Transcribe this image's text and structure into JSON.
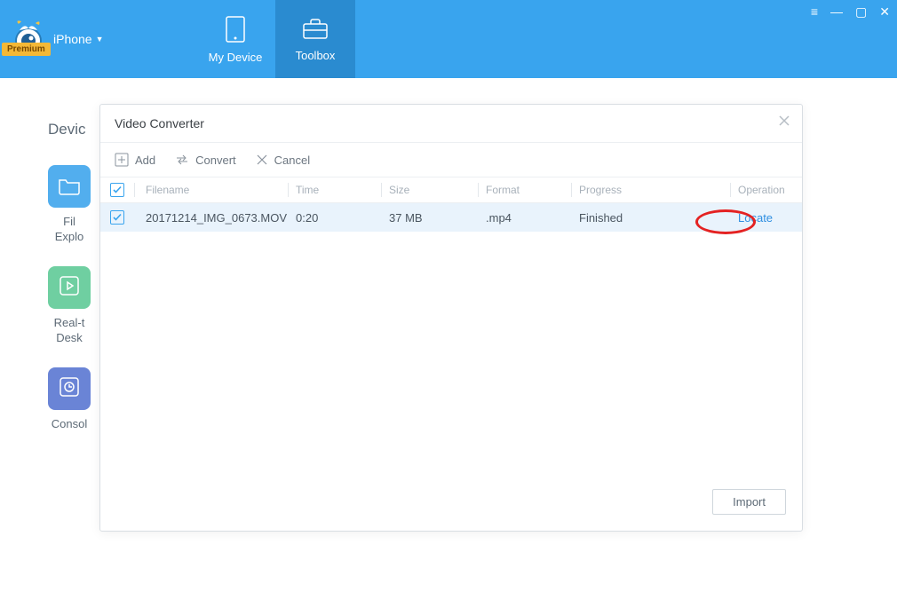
{
  "brand": {
    "device_label": "iPhone",
    "premium_badge": "Premium"
  },
  "nav": {
    "my_device": "My Device",
    "toolbox": "Toolbox"
  },
  "side": {
    "section": "Devic",
    "file_explorer": "Fil\nExplo",
    "real_time": "Real-t\nDesk",
    "console": "Consol"
  },
  "dialog": {
    "title": "Video Converter"
  },
  "toolbar": {
    "add": "Add",
    "convert": "Convert",
    "cancel": "Cancel"
  },
  "table": {
    "headers": {
      "filename": "Filename",
      "time": "Time",
      "size": "Size",
      "format": "Format",
      "progress": "Progress",
      "operation": "Operation"
    },
    "rows": [
      {
        "filename": "20171214_IMG_0673.MOV",
        "time": "0:20",
        "size": "37 MB",
        "format": ".mp4",
        "progress": "Finished",
        "operation": "Locate"
      }
    ]
  },
  "footer": {
    "import": "Import"
  }
}
